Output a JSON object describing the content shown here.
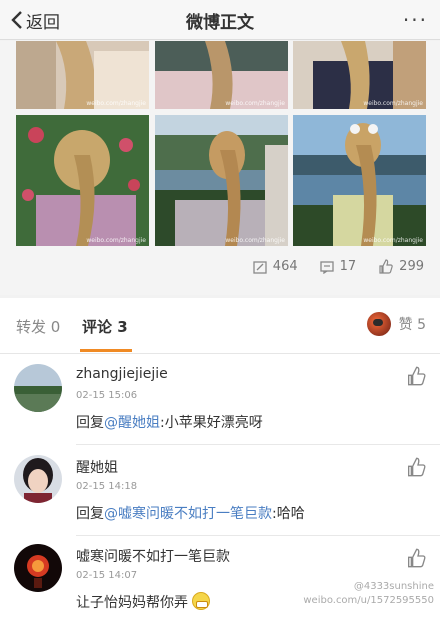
{
  "nav": {
    "back_label": "返回",
    "title": "微博正文",
    "more_label": "···"
  },
  "post": {
    "photo_watermark": "weibo.com/zhangjie",
    "stats": {
      "reposts": "464",
      "comments": "17",
      "likes": "299"
    }
  },
  "tabs": {
    "repost_label": "转发 0",
    "comment_label": "评论 3",
    "like_label": "赞 5"
  },
  "comments": [
    {
      "name": "zhangjiejiejie",
      "time": "02-15 15:06",
      "prefix": "回复",
      "mention": "@醒她姐",
      "text": ":小苹果好漂亮呀"
    },
    {
      "name": "醒她姐",
      "time": "02-15 14:18",
      "prefix": "回复",
      "mention": "@嘘寒问暖不如打一笔巨款",
      "text": ":哈哈"
    },
    {
      "name": "嘘寒问暖不如打一笔巨款",
      "time": "02-15 14:07",
      "prefix": "",
      "mention": "",
      "text": "让子怡妈妈帮你弄"
    }
  ],
  "watermark": {
    "line1": "@4333sunshine",
    "line2": "weibo.com/u/1572595550"
  },
  "colors": {
    "accent": "#f08a24",
    "mention": "#4a7ec2"
  }
}
